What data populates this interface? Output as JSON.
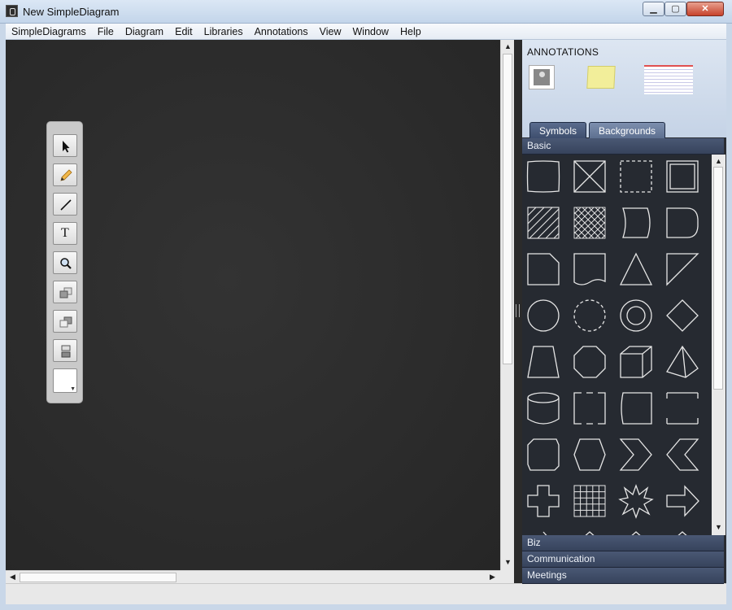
{
  "window": {
    "title": "New SimpleDiagram",
    "min_icon": "minimize-icon",
    "max_icon": "maximize-icon",
    "close_icon": "close-icon"
  },
  "menu": [
    "SimpleDiagrams",
    "File",
    "Diagram",
    "Edit",
    "Libraries",
    "Annotations",
    "View",
    "Window",
    "Help"
  ],
  "tools": [
    {
      "name": "select-tool",
      "icon": "arrow-pointer-icon"
    },
    {
      "name": "pencil-tool",
      "icon": "pencil-icon"
    },
    {
      "name": "line-tool",
      "icon": "line-icon"
    },
    {
      "name": "text-tool",
      "icon": "text-icon",
      "glyph": "T"
    },
    {
      "name": "zoom-tool",
      "icon": "magnifier-icon"
    },
    {
      "name": "bring-forward-tool",
      "icon": "bring-forward-icon"
    },
    {
      "name": "send-backward-tool",
      "icon": "send-backward-icon"
    },
    {
      "name": "align-tool",
      "icon": "align-icon"
    },
    {
      "name": "color-swatch",
      "icon": "color-swatch-icon"
    }
  ],
  "annotations": {
    "title": "ANNOTATIONS",
    "items": [
      "image-annotation-icon",
      "sticky-note-icon",
      "lined-paper-icon"
    ]
  },
  "tabs": [
    {
      "label": "Symbols",
      "active": true
    },
    {
      "label": "Backgrounds",
      "active": false
    }
  ],
  "library": {
    "open_section": "Basic",
    "collapsed_sections": [
      "Biz",
      "Communication",
      "Meetings"
    ]
  },
  "colors": {
    "canvas": "#2c2c2c",
    "panel": "#2a2d33",
    "section_header": "#3e4b66"
  }
}
